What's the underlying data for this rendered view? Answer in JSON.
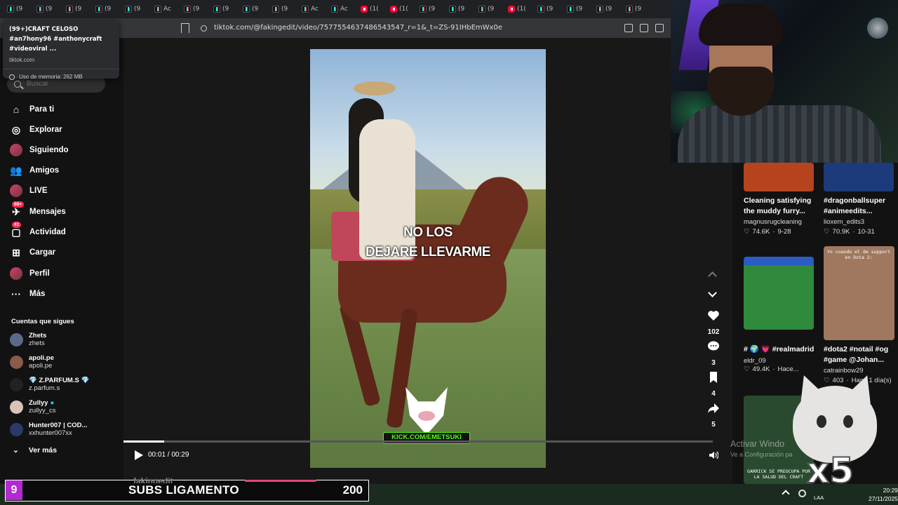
{
  "browser": {
    "tabs": [
      {
        "type": "tiktok",
        "label": "(9"
      },
      {
        "type": "tiktok",
        "label": "(9"
      },
      {
        "type": "tiktok",
        "label": "(9"
      },
      {
        "type": "tiktok",
        "label": "(9"
      },
      {
        "type": "tiktok",
        "label": "(9"
      },
      {
        "type": "tiktok",
        "label": "Ac"
      },
      {
        "type": "tiktok",
        "label": "(9"
      },
      {
        "type": "tiktok",
        "label": "(9"
      },
      {
        "type": "tiktok",
        "label": "(9"
      },
      {
        "type": "tiktok",
        "label": "(9"
      },
      {
        "type": "tiktok",
        "label": "Ac"
      },
      {
        "type": "tiktok",
        "label": "Ac"
      },
      {
        "type": "youtube",
        "label": "(1("
      },
      {
        "type": "youtube",
        "label": "(1("
      },
      {
        "type": "tiktok",
        "label": "(9"
      },
      {
        "type": "tiktok",
        "label": "(9"
      },
      {
        "type": "tiktok",
        "label": "(9"
      },
      {
        "type": "youtube",
        "label": "(1("
      },
      {
        "type": "tiktok",
        "label": "(9"
      },
      {
        "type": "tiktok",
        "label": "(9"
      },
      {
        "type": "tiktok",
        "label": "(9"
      },
      {
        "type": "tiktok",
        "label": "(9"
      }
    ],
    "url": "tiktok.com/@fakingedit/video/7577554637486543547_r=1&_t=ZS-91IHbEmWx0e",
    "tooltip": {
      "title": "(99+)CRAFT CELOSO #an7hony96 #anthonycraft #videoviral ...",
      "site": "tiktok.com",
      "memory": "Uso de memoria: 262 MB"
    }
  },
  "sidebar": {
    "search_placeholder": "Buscar",
    "nav": [
      {
        "label": "Para ti",
        "icon": "home-icon"
      },
      {
        "label": "Explorar",
        "icon": "compass-icon"
      },
      {
        "label": "Siguiendo",
        "icon": "following-icon"
      },
      {
        "label": "Amigos",
        "icon": "friends-icon"
      },
      {
        "label": "LIVE",
        "icon": "live-icon"
      },
      {
        "label": "Mensajes",
        "icon": "messages-icon",
        "badge": "99+"
      },
      {
        "label": "Actividad",
        "icon": "activity-icon",
        "badge": "41"
      },
      {
        "label": "Cargar",
        "icon": "upload-icon"
      },
      {
        "label": "Perfil",
        "icon": "profile-icon"
      },
      {
        "label": "Más",
        "icon": "more-icon"
      }
    ],
    "following_title": "Cuentas que sigues",
    "accounts": [
      {
        "name": "Zhets",
        "handle": "zhets",
        "color": "#5a6b8a"
      },
      {
        "name": "apoli.pe",
        "handle": "apoli.pe",
        "color": "#8a5a4a"
      },
      {
        "name": "💎 Z.PARFUM.S 💎",
        "handle": "z.parfum.s",
        "color": "#222222"
      },
      {
        "name": "Zullyy",
        "handle": "zullyy_cs",
        "color": "#d9c2b8",
        "verified": true
      },
      {
        "name": "Hunter007 | COD...",
        "handle": "xxhunter007xx",
        "color": "#2a3a6a"
      }
    ],
    "see_more": "Ver más"
  },
  "video": {
    "caption_line1": "NO LOS",
    "caption_line2": "DEJARE LLEVARME",
    "watermark": "KICK.COM/EMETSUKI",
    "time": "00:01 / 00:29",
    "progress": 0.069,
    "likes": "102",
    "comments": "3",
    "saves": "4",
    "shares": "5",
    "author_partial": "fakingedit"
  },
  "recommendations": [
    {
      "title": "Cleaning satisfying the muddy furry...",
      "user": "magnusrugcleaning",
      "likes": "74.6K",
      "date": "9-28",
      "thumb": "#b5441e"
    },
    {
      "title": "#dragonballsuper #animeedits...",
      "user": "lioxem_edits3",
      "likes": "70.9K",
      "date": "10-31",
      "thumb": "#1d3a7a"
    },
    {
      "title": "# 🌍 💗 #realmadrid",
      "user": "eldr_09",
      "likes": "49.4K",
      "date": "Hace...",
      "thumb": "#2f7d3a"
    },
    {
      "title": "#dota2 #notail #og #game @Johan...",
      "user": "catrainbow29",
      "likes": "403",
      "date": "Hace 1 día(s)",
      "thumb": "#a07860",
      "overlay": "Yo cuando el de support en Dota 2:"
    },
    {
      "title": "",
      "user": "",
      "likes": "",
      "date": "",
      "thumb": "#2a4a2f",
      "overlay": "GARRICK SE PREOCUPA POR LA SALUD DEL CRAFT"
    }
  ],
  "windows_watermark": {
    "line1": "Activar Windo",
    "line2": "Ve a Configuración pa"
  },
  "cat_overlay_text": "x5",
  "subs_goal": {
    "count": "9",
    "label": "SUBS LIGAMENTO",
    "target": "200",
    "progress": 0.045
  },
  "taskbar": {
    "lang": "LAA",
    "time": "20:29",
    "date": "27/11/2025"
  },
  "colors": {
    "accent": "#fe2c55",
    "kick_green": "#53fc18",
    "subs_purple": "#b32ad1"
  }
}
